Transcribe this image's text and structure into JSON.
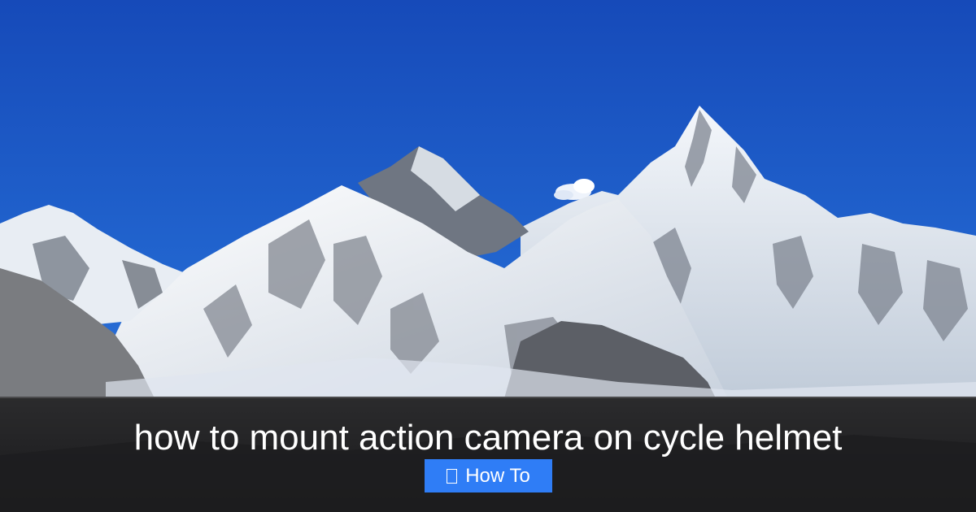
{
  "photo": {
    "subject": "snow-capped-mountain-peaks",
    "sky_color": "#1d55c4"
  },
  "caption": {
    "title": "how to mount action camera on cycle helmet"
  },
  "badge": {
    "icon": "missing-glyph-icon",
    "label": "How To",
    "color": "#2f7df6"
  }
}
